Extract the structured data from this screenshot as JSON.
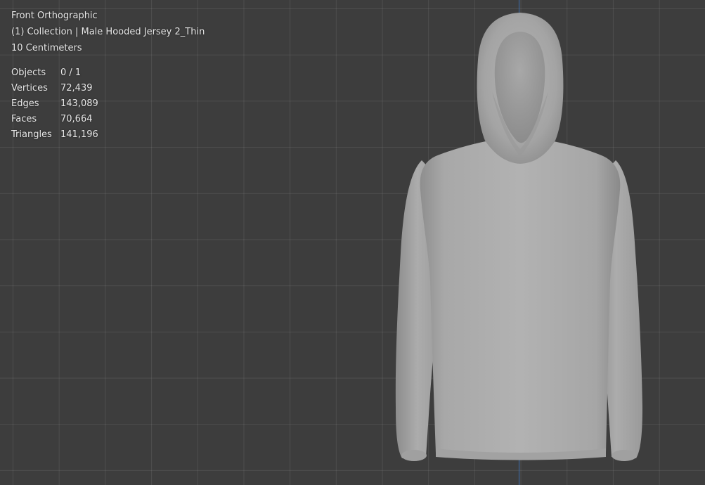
{
  "viewport": {
    "view_name": "Front Orthographic",
    "collection_line": "(1) Collection | Male Hooded Jersey 2_Thin",
    "grid_scale": "10 Centimeters"
  },
  "stats": [
    {
      "label": "Objects",
      "value": "0 / 1"
    },
    {
      "label": "Vertices",
      "value": "72,439"
    },
    {
      "label": "Edges",
      "value": "143,089"
    },
    {
      "label": "Faces",
      "value": "70,664"
    },
    {
      "label": "Triangles",
      "value": "141,196"
    }
  ],
  "colors": {
    "background": "#3d3d3d",
    "grid_line": "#4f4f4f",
    "z_axis": "#3e6fae",
    "mesh": "#a9a9a9",
    "overlay_text": "#e8e8e8"
  }
}
